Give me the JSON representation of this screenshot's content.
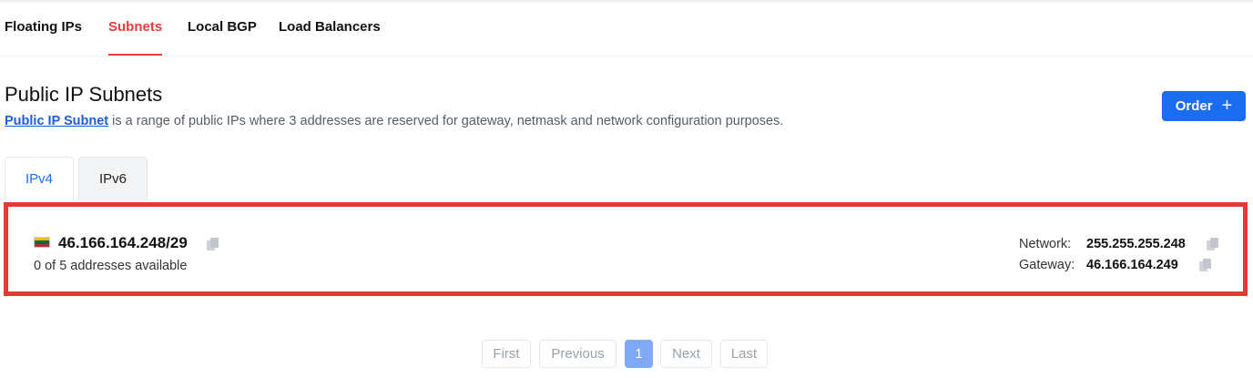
{
  "nav": {
    "tabs": [
      "Floating IPs",
      "Subnets",
      "Local BGP",
      "Load Balancers"
    ],
    "active": "Subnets"
  },
  "header": {
    "title": "Public IP Subnets",
    "link_text": "Public IP Subnet",
    "description": " is a range of public IPs where 3 addresses are reserved for gateway, netmask and network configuration purposes.",
    "order_label": "Order"
  },
  "tabs": {
    "ipv4": "IPv4",
    "ipv6": "IPv6",
    "active": "IPv4"
  },
  "subnet": {
    "cidr": "46.166.164.248/29",
    "availability": "0 of 5 addresses available",
    "network_label": "Network:",
    "network_value": "255.255.255.248",
    "gateway_label": "Gateway:",
    "gateway_value": "46.166.164.249",
    "flag_colors": [
      "#fdb913",
      "#006a44",
      "#c1272d"
    ]
  },
  "pagination": {
    "first": "First",
    "previous": "Previous",
    "current": "1",
    "next": "Next",
    "last": "Last"
  },
  "colors": {
    "accent": "#e53e3e",
    "primary": "#1a6cf0",
    "highlight_border": "#e53935"
  }
}
